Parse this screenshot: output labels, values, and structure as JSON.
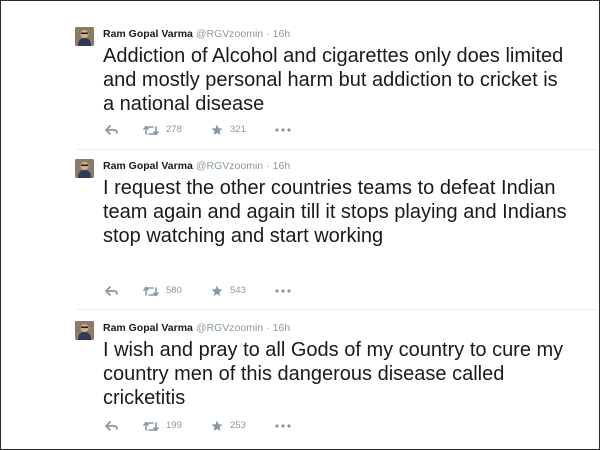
{
  "tweets": [
    {
      "name": "Ram Gopal Varma",
      "handle": "@RGVzoomin",
      "separator": "·",
      "time": "16h",
      "text": "Addiction of Alcohol and cigarettes only does limited and mostly personal harm but addiction to cricket is a national disease",
      "retweets": "278",
      "favorites": "321",
      "icons": {
        "reply": "reply-icon",
        "retweet": "retweet-icon",
        "favorite": "star-icon",
        "more": "more-icon"
      }
    },
    {
      "name": "Ram Gopal Varma",
      "handle": "@RGVzoomin",
      "separator": "·",
      "time": "16h",
      "text": "I request the other countries teams to defeat Indian team again and again till it stops playing and Indians stop watching and start working",
      "retweets": "580",
      "favorites": "543",
      "icons": {
        "reply": "reply-icon",
        "retweet": "retweet-icon",
        "favorite": "star-icon",
        "more": "more-icon"
      }
    },
    {
      "name": "Ram Gopal Varma",
      "handle": "@RGVzoomin",
      "separator": "·",
      "time": "16h",
      "text": "I wish and pray to all Gods of my country to cure my country men of this dangerous disease called cricketitis",
      "retweets": "199",
      "favorites": "253",
      "icons": {
        "reply": "reply-icon",
        "retweet": "retweet-icon",
        "favorite": "star-icon",
        "more": "more-icon"
      }
    }
  ],
  "colors": {
    "name": "#1a1a1a",
    "meta": "#8899a6",
    "divider": "#e6ecf0",
    "border": "#2b2b2b"
  }
}
